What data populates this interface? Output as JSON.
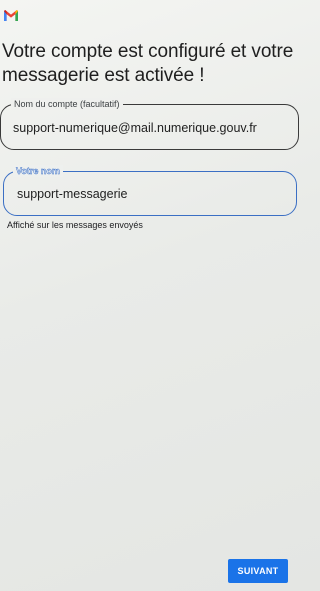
{
  "app": {
    "logo_icon": "gmail-logo-icon",
    "colors": {
      "accent": "#1a73e8",
      "focus_outline": "#3b6fc4",
      "logo_red": "#ea4335"
    }
  },
  "title": "Votre compte est configuré et votre messagerie est activée !",
  "account_field": {
    "label": "Nom du compte (facultatif)",
    "value": "support-numerique@mail.numerique.gouv.fr"
  },
  "name_field": {
    "label": "Votre nom",
    "value": "support-messagerie",
    "helper": "Affiché sur les messages envoyés"
  },
  "next_button": {
    "label": "SUIVANT"
  }
}
